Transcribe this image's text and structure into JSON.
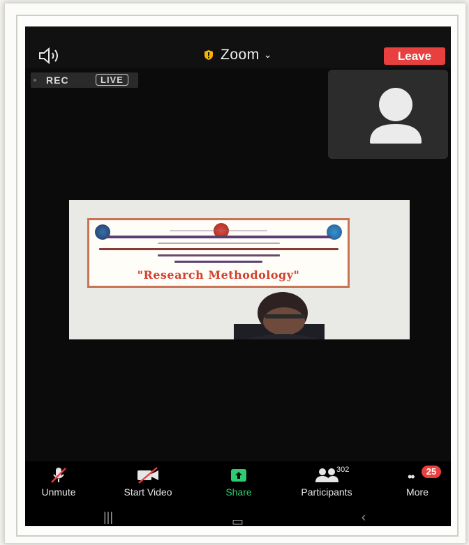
{
  "meeting": {
    "title": "Zoom",
    "leave_label": "Leave",
    "rec_label": "REC",
    "live_label": "LIVE"
  },
  "video": {
    "banner_title": "\"Research Methodology\""
  },
  "toolbar": {
    "unmute_label": "Unmute",
    "start_video_label": "Start Video",
    "share_label": "Share",
    "participants_label": "Participants",
    "participants_count": "302",
    "more_label": "More",
    "more_badge": "25"
  },
  "colors": {
    "leave": "#e8403f",
    "share": "#2ecc71",
    "badge": "#e8403f",
    "background": "#0b0b0b"
  },
  "icons": [
    "speaker-icon",
    "shield-icon",
    "chevron-down-icon",
    "avatar-placeholder-icon",
    "mic-muted-icon",
    "video-off-icon",
    "share-arrow-icon",
    "participants-icon",
    "more-dots-icon"
  ]
}
